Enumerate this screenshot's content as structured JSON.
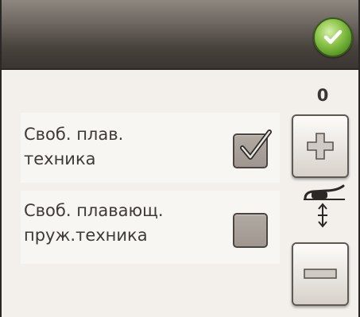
{
  "header": {
    "ok_icon": "checkmark-icon",
    "accent_color": "#6aad2e"
  },
  "counter": {
    "value": "0"
  },
  "options": [
    {
      "label": "Своб. плав.\nтехника",
      "checked": true
    },
    {
      "label": "Своб. плавающ.\nпруж.техника",
      "checked": false
    }
  ],
  "controls": {
    "increase_icon": "plus-icon",
    "decrease_icon": "minus-icon",
    "indicator_icon": "presser-foot-height-icon"
  }
}
